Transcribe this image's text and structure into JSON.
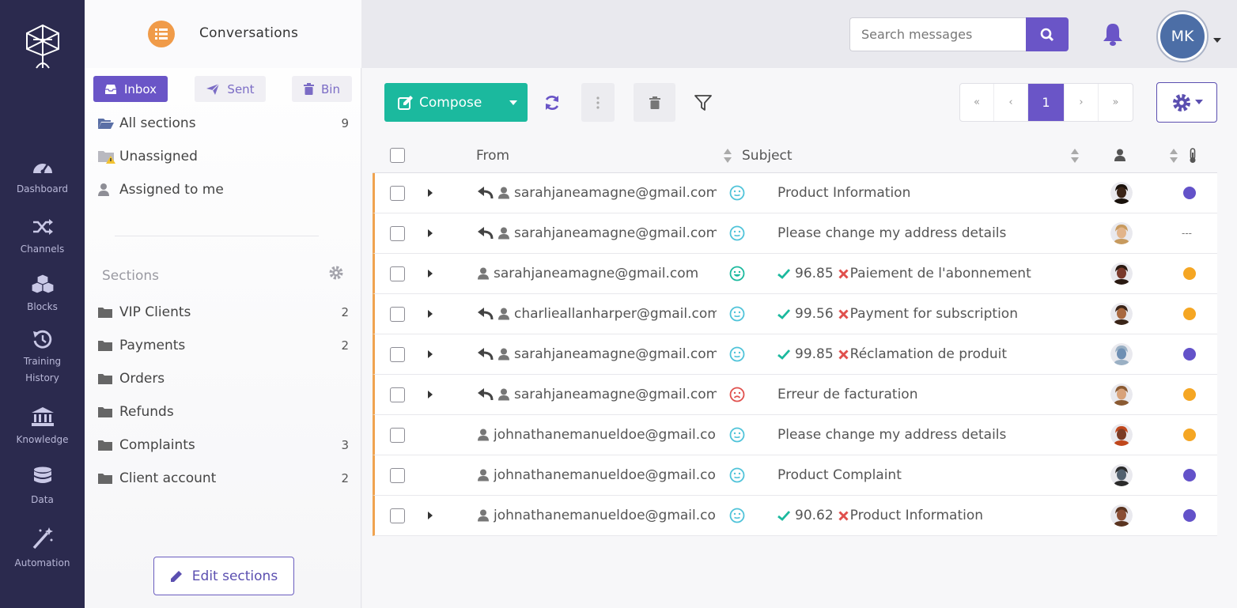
{
  "nav": {
    "items": [
      {
        "label": "Dashboard",
        "icon": "dashboard-icon"
      },
      {
        "label": "Channels",
        "icon": "shuffle-icon"
      },
      {
        "label": "Blocks",
        "icon": "cubes-icon"
      },
      {
        "label": "Training",
        "label2": "History",
        "icon": "history-icon"
      },
      {
        "label": "Knowledge",
        "icon": "bank-icon"
      },
      {
        "label": "Data",
        "icon": "database-icon"
      },
      {
        "label": "Automation",
        "icon": "magic-wand-icon"
      }
    ]
  },
  "panel": {
    "title": "Conversations",
    "tabs": {
      "inbox": "Inbox",
      "sent": "Sent",
      "bin": "Bin"
    },
    "folders": [
      {
        "label": "All sections",
        "count": "9",
        "icon": "folder-open-icon"
      },
      {
        "label": "Unassigned",
        "count": "",
        "icon": "folder-warning-icon"
      },
      {
        "label": "Assigned to me",
        "count": "",
        "icon": "user-icon"
      }
    ],
    "sections_title": "Sections",
    "sections": [
      {
        "label": "VIP Clients",
        "count": "2"
      },
      {
        "label": "Payments",
        "count": "2"
      },
      {
        "label": "Orders",
        "count": ""
      },
      {
        "label": "Refunds",
        "count": ""
      },
      {
        "label": "Complaints",
        "count": "3"
      },
      {
        "label": "Client account",
        "count": "2"
      }
    ],
    "edit_label": "Edit sections"
  },
  "header": {
    "search_placeholder": "Search messages",
    "user_initials": "MK"
  },
  "toolbar": {
    "compose_label": "Compose"
  },
  "pagination": {
    "first": "«",
    "prev": "‹",
    "current": "1",
    "next": "›",
    "last": "»"
  },
  "table": {
    "columns": {
      "from": "From",
      "subject": "Subject"
    },
    "rows": [
      {
        "expandable": true,
        "replied": true,
        "from": "sarahjaneamagne@gmail.com",
        "sentiment": "neutral",
        "score": "",
        "subject": "Product Information",
        "status": "purple"
      },
      {
        "expandable": true,
        "replied": true,
        "from": "sarahjaneamagne@gmail.com",
        "sentiment": "neutral",
        "score": "",
        "subject": "Please change my address details",
        "status": "---"
      },
      {
        "expandable": true,
        "replied": false,
        "from": "sarahjaneamagne@gmail.com",
        "sentiment": "happy",
        "score": "96.85",
        "subject": "Paiement de l'abonnement",
        "status": "orange"
      },
      {
        "expandable": true,
        "replied": true,
        "from": "charlieallanharper@gmail.com",
        "sentiment": "neutral",
        "score": "99.56",
        "subject": "Payment for subscription",
        "status": "orange"
      },
      {
        "expandable": true,
        "replied": true,
        "from": "sarahjaneamagne@gmail.com",
        "sentiment": "neutral",
        "score": "99.85",
        "subject": "Réclamation de produit",
        "status": "purple"
      },
      {
        "expandable": true,
        "replied": true,
        "from": "sarahjaneamagne@gmail.com",
        "sentiment": "angry",
        "score": "",
        "subject": "Erreur de facturation",
        "status": "orange"
      },
      {
        "expandable": false,
        "replied": false,
        "from": "johnathanemanueldoe@gmail.com",
        "sentiment": "neutral",
        "score": "",
        "subject": "Please change my address details",
        "status": "orange"
      },
      {
        "expandable": false,
        "replied": false,
        "from": "johnathanemanueldoe@gmail.com",
        "sentiment": "neutral",
        "score": "",
        "subject": "Product Complaint",
        "status": "purple"
      },
      {
        "expandable": true,
        "replied": false,
        "from": "johnathanemanueldoe@gmail.com",
        "sentiment": "neutral",
        "score": "90.62",
        "subject": "Product Information",
        "status": "purple"
      }
    ]
  },
  "colors": {
    "accent": "#6a55c7",
    "compose": "#1bb99e",
    "rail": "#2b2a4e",
    "status_purple": "#6352c9",
    "status_orange": "#f5a623",
    "sentiment_neutral": "#4fc3d9",
    "sentiment_happy": "#1bb99e",
    "sentiment_angry": "#e0504d",
    "row_marker": "#f0a34f"
  }
}
